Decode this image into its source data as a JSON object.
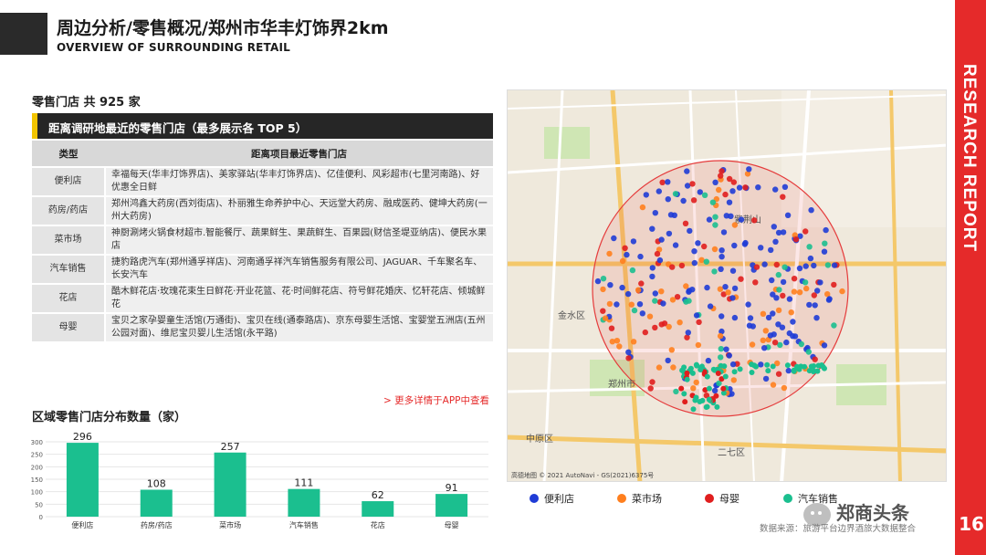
{
  "header": {
    "title": "周边分析/零售概况/郑州市华丰灯饰界2km",
    "subtitle": "OVERVIEW OF SURROUNDING RETAIL"
  },
  "side": {
    "report_label": "RESEARCH REPORT",
    "page_number": "16"
  },
  "stores": {
    "count_label": "零售门店 共 925 家",
    "table_title": "距离调研地最近的零售门店（最多展示各 TOP 5）",
    "columns": [
      "类型",
      "距离项目最近零售门店"
    ],
    "rows": [
      {
        "type": "便利店",
        "stores": "幸福每天(华丰灯饰界店)、美家驿站(华丰灯饰界店)、亿佳便利、风彩超市(七里河南路)、好优惠全日鲜"
      },
      {
        "type": "药房/药店",
        "stores": "郑州鸿鑫大药房(西刘街店)、朴丽雅生命养护中心、天远堂大药房、融成医药、健坤大药房(一州大药房)"
      },
      {
        "type": "菜市场",
        "stores": "神厨涮烤火锅食材超市.智能餐厅、蔬果鲜生、果蔬鲜生、百果园(财信圣堤亚纳店)、便民水果店"
      },
      {
        "type": "汽车销售",
        "stores": "捷豹路虎汽车(郑州通孚祥店)、河南通孚祥汽车销售服务有限公司、JAGUAR、千车聚名车、长安汽车"
      },
      {
        "type": "花店",
        "stores": "酷木鲜花店·玫瑰花束生日鲜花·开业花篮、花·时间鲜花店、符号鲜花婚庆、忆轩花店、倾城鲜花"
      },
      {
        "type": "母婴",
        "stores": "宝贝之家孕婴童生活馆(万通街)、宝贝在线(通泰路店)、京东母婴生活馆、宝婴堂五洲店(五州公园对面)、维尼宝贝婴儿生活馆(永平路)"
      }
    ]
  },
  "more_link": "> 更多详情于APP中查看",
  "distribution": {
    "title": "区域零售门店分布数量（家）",
    "chart_data": {
      "type": "bar",
      "categories": [
        "便利店",
        "药房/药店",
        "菜市场",
        "汽车销售",
        "花店",
        "母婴"
      ],
      "values": [
        296,
        108,
        257,
        111,
        62,
        91
      ],
      "yticks": [
        0,
        50,
        100,
        150,
        200,
        250,
        300
      ],
      "ylim": [
        0,
        300
      ],
      "color": "#1bbf8f",
      "grid": true
    }
  },
  "map": {
    "labels": [
      "紫荆山",
      "金水区",
      "中原区",
      "二七区",
      "郑州市"
    ],
    "colors": {
      "background": "#efe9dc",
      "circle": "#e53c3c",
      "road": "#ffffff",
      "main_road": "#f4c86a",
      "park": "#cfe6b4"
    },
    "attribution": "高德地图 © 2021 AutoNavi - GS(2021)6375号"
  },
  "legend": [
    {
      "label": "便利店",
      "color": "#1f3cd6"
    },
    {
      "label": "菜市场",
      "color": "#ff7f1e"
    },
    {
      "label": "母婴",
      "color": "#e01e1e"
    },
    {
      "label": "汽车销售",
      "color": "#1bbf8f"
    }
  ],
  "source": "数据来源：旅游平台边界酒旅大数据整合",
  "watermark": "郑商头条"
}
